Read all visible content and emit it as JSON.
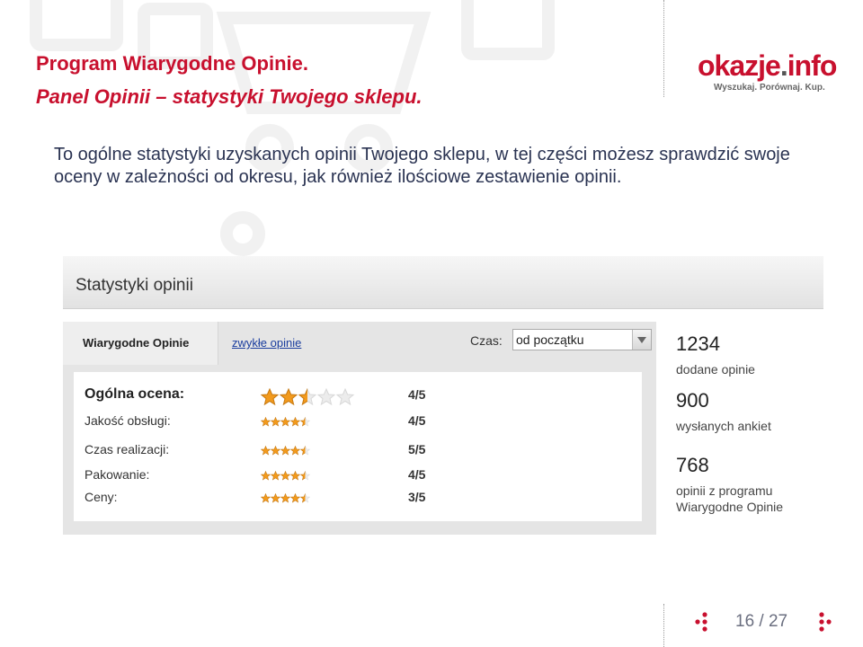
{
  "title_line1": "Program Wiarygodne Opinie.",
  "title_line2": "Panel Opinii – statystyki Twojego sklepu.",
  "logo": {
    "part1": "okazje",
    "part2": ".",
    "part3": "info",
    "tagline": "Wyszukaj. Porównaj. Kup."
  },
  "intro": "To ogólne statystyki uzyskanych opinii Twojego sklepu, w tej części możesz sprawdzić swoje oceny w zależności od okresu, jak również ilościowe zestawienie opinii.",
  "panel": {
    "title": "Statystyki opinii",
    "tabs": [
      {
        "label": "Wiarygodne Opinie",
        "active": true
      },
      {
        "label": "zwykłe opinie",
        "active": false
      }
    ],
    "czas_label": "Czas:",
    "czas_value": "od początku",
    "ratings": [
      {
        "label": "Ogólna ocena:",
        "score": "4/5",
        "stars": 2.5
      },
      {
        "label": "Jakość obsługi:",
        "score": "4/5",
        "stars": 4.5
      },
      {
        "label": "Czas realizacji:",
        "score": "5/5",
        "stars": 4.5
      },
      {
        "label": "Pakowanie:",
        "score": "4/5",
        "stars": 4.5
      },
      {
        "label": "Ceny:",
        "score": "3/5",
        "stars": 4.5
      }
    ],
    "stats": [
      {
        "number": "1234",
        "desc_line1": "dodane opinie",
        "desc_line2": ""
      },
      {
        "number": "900",
        "desc_line1": "wysłanych ankiet",
        "desc_line2": ""
      },
      {
        "number": "768",
        "desc_line1": "opinii z programu",
        "desc_line2": "Wiarygodne Opinie"
      }
    ]
  },
  "pager": {
    "text": "16 / 27"
  },
  "colors": {
    "brand_red": "#c8102e",
    "star_orange": "#f29a1d",
    "link_blue": "#1a3d9e"
  }
}
